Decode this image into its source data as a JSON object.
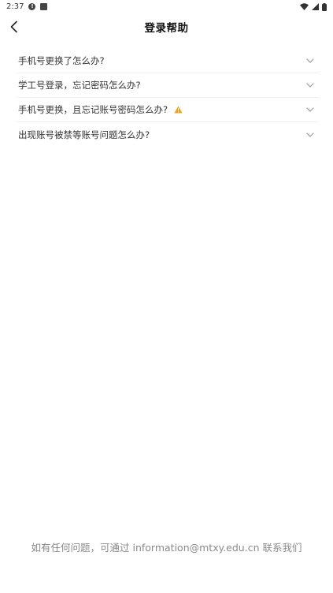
{
  "status": {
    "time": "2:37"
  },
  "header": {
    "title": "登录帮助"
  },
  "faq": [
    {
      "label": "手机号更换了怎么办?"
    },
    {
      "label": "学工号登录，忘记密码怎么办?"
    },
    {
      "label": "手机号更换，且忘记账号密码怎么办?",
      "warning": true
    },
    {
      "label": "出现账号被禁等账号问题怎么办?"
    }
  ],
  "footer": {
    "text": "如有任何问题，可通过 information@mtxy.edu.cn 联系我们"
  },
  "colors": {
    "warning": "#f0a020",
    "chevron": "#999999"
  }
}
